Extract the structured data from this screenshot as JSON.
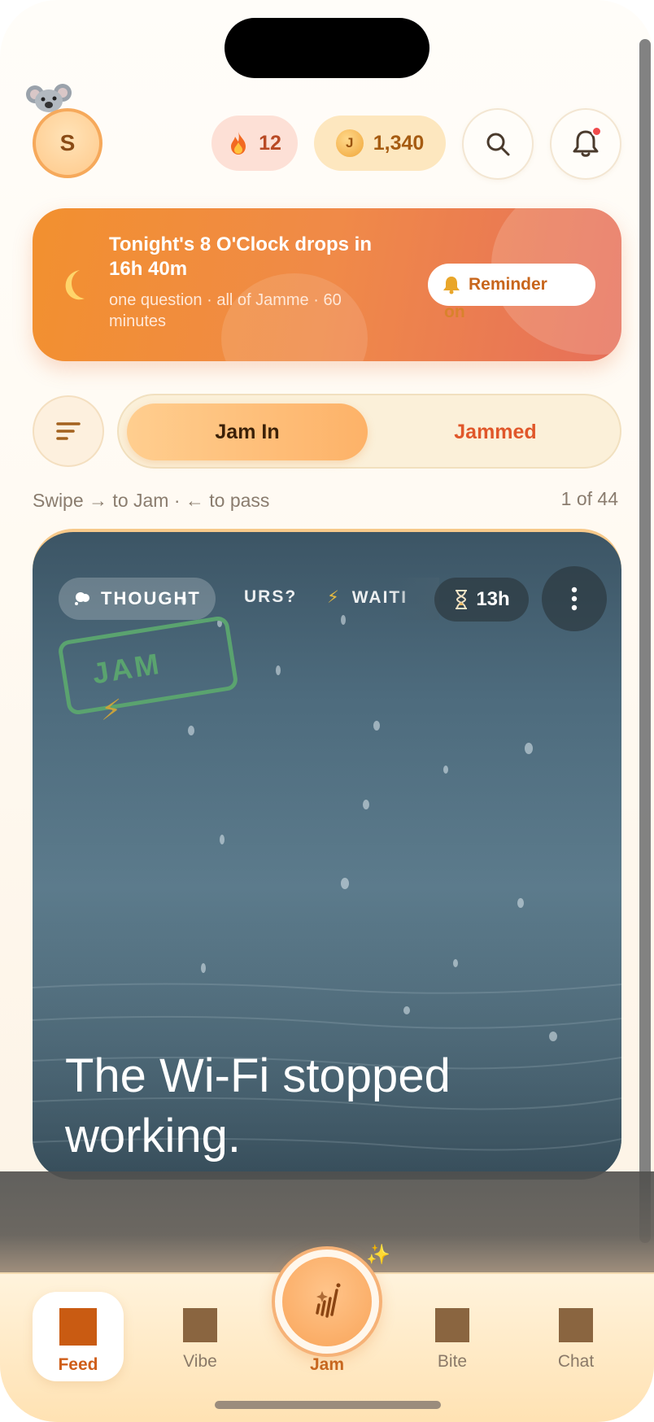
{
  "header": {
    "avatar_initial": "S",
    "streak_icon": "fire-icon",
    "streak_count": "12",
    "coin_symbol": "J",
    "coin_count": "1,340",
    "search_icon": "search-icon",
    "bell_icon": "bell-icon"
  },
  "banner": {
    "icon": "moon-icon",
    "title": "Tonight's 8 O'Clock drops in 16h 40m",
    "subtitle": "one question · all of Jamme · 60 minutes",
    "reminder_label": "Reminder",
    "reminder_state": "on"
  },
  "segment": {
    "active": "Jam In",
    "inactive": "Jammed"
  },
  "feed": {
    "hint": "Swipe → to Jam · ← to pass",
    "counter": "1 of 44"
  },
  "card": {
    "tag_thought": "THOUGHT",
    "tag_yours": "URS?",
    "tag_waiting": "WAITI",
    "timer": "13h",
    "stamp": "JAM",
    "text": "The Wi-Fi stopped working."
  },
  "nav": {
    "feed": "Feed",
    "vibe": "Vibe",
    "jam": "Jam",
    "bite": "Bite",
    "chat": "Chat"
  },
  "colors": {
    "accent": "#f2902f",
    "active_nav": "#c95b12",
    "jammed": "#e0572a",
    "stamp": "#5aa36f"
  }
}
